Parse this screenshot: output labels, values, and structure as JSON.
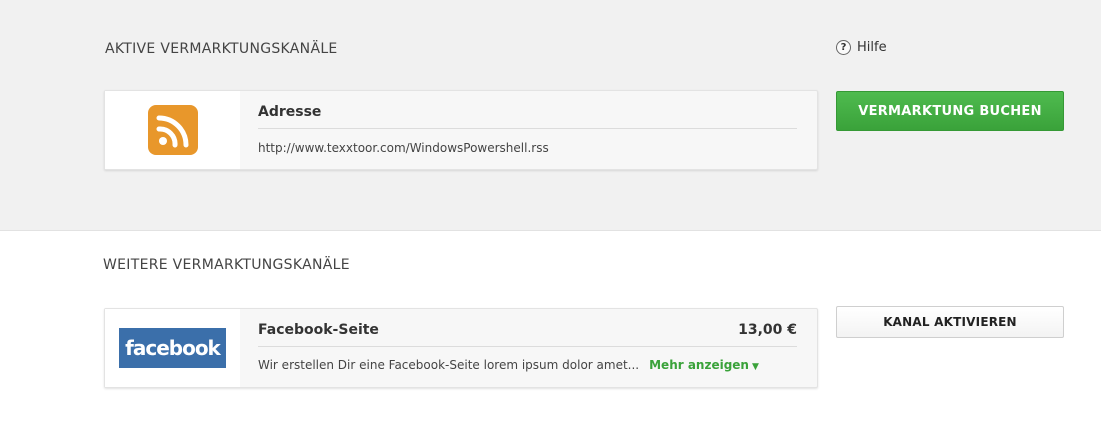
{
  "active_section": {
    "title": "AKTIVE VERMARKTUNGSKANÄLE",
    "help_label": "Hilfe",
    "help_icon_glyph": "?",
    "card": {
      "icon": "rss-feed-icon",
      "title": "Adresse",
      "url": "http://www.texxtoor.com/WindowsPowershell.rss"
    },
    "book_button": "VERMARKTUNG BUCHEN"
  },
  "more_section": {
    "title": "WEITERE VERMARKTUNGSKANÄLE",
    "card": {
      "logo_text": "facebook",
      "title": "Facebook-Seite",
      "price": "13,00 €",
      "description": "Wir erstellen Dir eine Facebook-Seite lorem ipsum dolor amet...",
      "more_link": "Mehr anzeigen",
      "more_arrow": "▼"
    },
    "activate_button": "KANAL AKTIVIEREN"
  },
  "colors": {
    "accent_green": "#3aa23a",
    "rss_orange": "#e8972b",
    "facebook_blue": "#3b6faa",
    "top_background": "#f1f1f1"
  }
}
